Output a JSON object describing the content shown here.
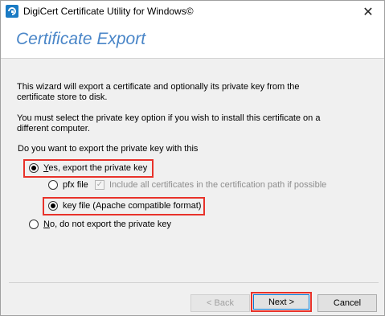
{
  "window": {
    "title": "DigiCert Certificate Utility for Windows©",
    "close_glyph": "✕",
    "accent_color": "#4a86c8",
    "icon": "digicert-logo-icon"
  },
  "header": {
    "title": "Certificate Export"
  },
  "body": {
    "intro": "This wizard will export a certificate and optionally its private key from the certificate store to disk.",
    "instruction": "You must select the private key option if you wish to install this certificate on a different computer.",
    "question": "Do you want to export the private key with this"
  },
  "options": {
    "yes": {
      "mnemonic": "Y",
      "rest": "es, export the private key",
      "selected": true
    },
    "pfx": {
      "label": "pfx file",
      "selected": false
    },
    "include_chain": {
      "label": "Include all certificates in the certification path if possible",
      "checked": true,
      "enabled": false
    },
    "keyfile": {
      "label": "key file (Apache compatible format)",
      "selected": true
    },
    "no": {
      "mnemonic": "N",
      "rest": "o, do not export the private key",
      "selected": false
    }
  },
  "buttons": {
    "back": "< Back",
    "next": "Next >",
    "cancel": "Cancel"
  },
  "highlight_color": "#e8322a"
}
